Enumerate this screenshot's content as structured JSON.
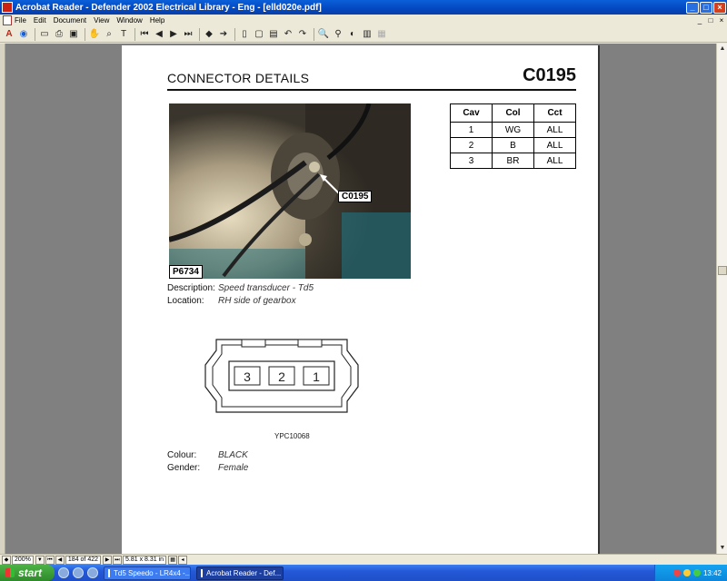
{
  "window": {
    "title": "Acrobat Reader - Defender 2002 Electrical Library - Eng - [elld020e.pdf]",
    "controls": [
      "_",
      "□",
      "×"
    ]
  },
  "menu": {
    "items": [
      "File",
      "Edit",
      "Document",
      "View",
      "Window",
      "Help"
    ],
    "doc_controls": [
      "_",
      "□",
      "×"
    ]
  },
  "toolbar": {
    "icons": [
      "open-icon",
      "print-icon",
      "save-icon",
      "hand-icon",
      "zoom-icon",
      "text-select-icon",
      "first-page-icon",
      "prev-page-icon",
      "next-page-icon",
      "last-page-icon",
      "back-icon",
      "forward-icon",
      "actual-size-icon",
      "fit-page-icon",
      "fit-width-icon",
      "rotate-left-icon",
      "rotate-right-icon",
      "find-icon"
    ]
  },
  "page": {
    "header_title": "CONNECTOR DETAILS",
    "connector_code": "C0195",
    "photo_tag": "P6734",
    "photo_callout": "C0195",
    "pin_table": {
      "headers": [
        "Cav",
        "Col",
        "Cct"
      ],
      "rows": [
        [
          "1",
          "WG",
          "ALL"
        ],
        [
          "2",
          "B",
          "ALL"
        ],
        [
          "3",
          "BR",
          "ALL"
        ]
      ]
    },
    "description_label": "Description:",
    "description_value": "Speed transducer - Td5",
    "location_label": "Location:",
    "location_value": "RH side of gearbox",
    "pins_drawn": [
      "3",
      "2",
      "1"
    ],
    "figure_code": "YPC10068",
    "colour_label": "Colour:",
    "colour_value": "BLACK",
    "gender_label": "Gender:",
    "gender_value": "Female"
  },
  "statusbar": {
    "zoom": "200%",
    "page_indicator": "184 of 422",
    "page_size": "5.81 x 8.31 in"
  },
  "taskbar": {
    "start_label": "start",
    "tasks": [
      {
        "label": "Td5 Speedo - LR4x4 -...",
        "active": false
      },
      {
        "label": "Acrobat Reader - Def...",
        "active": true
      }
    ],
    "clock": "13:42"
  },
  "colors": {
    "titlebar": "#0348c0",
    "taskbar": "#2458d8",
    "start_button": "#2f8a2a"
  }
}
